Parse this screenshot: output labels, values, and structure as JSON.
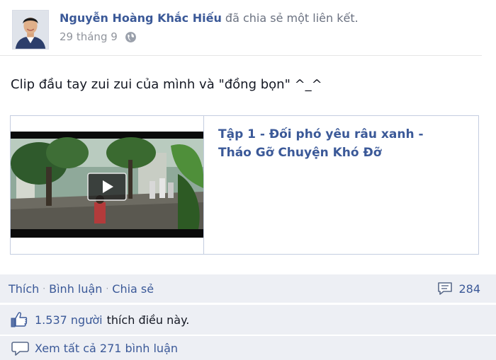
{
  "post": {
    "author_name": "Nguyễn Hoàng Khắc Hiếu",
    "action_text": "đã chia sẻ một liên kết.",
    "timestamp": "29 tháng 9",
    "message": "Clip đầu tay zui zui của mình và \"đồng bọn\" ^_^"
  },
  "attachment": {
    "title": "Tập 1 - Đối phó yêu râu xanh - Tháo Gỡ Chuyện Khó Đỡ"
  },
  "actions": {
    "like": "Thích",
    "comment": "Bình luận",
    "share": "Chia sẻ",
    "separator": "·",
    "comments_count": "284"
  },
  "likes": {
    "count": "1.537 người",
    "suffix": "thích điều này."
  },
  "comments": {
    "view_all": "Xem tất cả 271 bình luận"
  },
  "icons": {
    "privacy": "globe-icon",
    "play": "play-icon",
    "likes": "thumbs-up-icon",
    "comments": "comment-bubble-icon",
    "comment_count": "comment-count-icon"
  },
  "colors": {
    "link": "#3b5998",
    "bar_background": "#edeff4",
    "border": "#c4cde0"
  }
}
